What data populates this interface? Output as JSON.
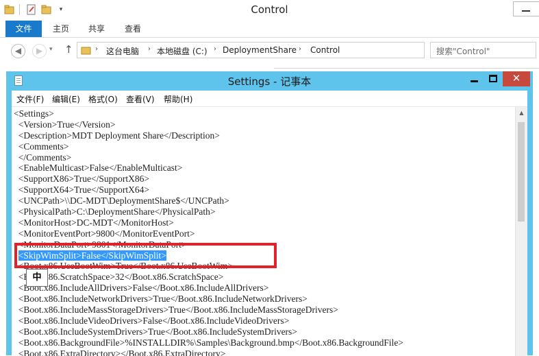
{
  "explorer": {
    "title": "Control",
    "ribbon_tabs": [
      "文件",
      "主页",
      "共享",
      "查看"
    ],
    "breadcrumb": [
      "这台电脑",
      "本地磁盘 (C:)",
      "DeploymentShare",
      "Control"
    ],
    "search_placeholder": "搜索\"Control\""
  },
  "notepad": {
    "title": "Settings - 记事本",
    "menu": [
      "文件(F)",
      "编辑(E)",
      "格式(O)",
      "查看(V)",
      "帮助(H)"
    ],
    "lines": [
      "<Settings>",
      "  <Version>True</Version>",
      "  <Description>MDT Deployment Share</Description>",
      "  <Comments>",
      "  </Comments>",
      "  <EnableMulticast>False</EnableMulticast>",
      "  <SupportX86>True</SupportX86>",
      "  <SupportX64>True</SupportX64>",
      "  <UNCPath>\\\\DC-MDT\\DeploymentShare$</UNCPath>",
      "  <PhysicalPath>C:\\DeploymentShare</PhysicalPath>",
      "  <MonitorHost>DC-MDT</MonitorHost>",
      "  <MonitorEventPort>9800</MonitorEventPort>",
      "  <MonitorDataPort>9801</MonitorDataPort>",
      "  <SkipWimSplit>False</SkipWimSplit>",
      "  <Boot.x86.UseBootWim>True</Boot.x86.UseBootWim>",
      "  <Boot.x86.ScratchSpace>32</Boot.x86.ScratchSpace>",
      "  <Boot.x86.IncludeAllDrivers>False</Boot.x86.IncludeAllDrivers>",
      "  <Boot.x86.IncludeNetworkDrivers>True</Boot.x86.IncludeNetworkDrivers>",
      "  <Boot.x86.IncludeMassStorageDrivers>True</Boot.x86.IncludeMassStorageDrivers>",
      "  <Boot.x86.IncludeVideoDrivers>False</Boot.x86.IncludeVideoDrivers>",
      "  <Boot.x86.IncludeSystemDrivers>True</Boot.x86.IncludeSystemDrivers>",
      "  <Boot.x86.BackgroundFile>%INSTALLDIR%\\Samples\\Background.bmp</Boot.x86.BackgroundFile>",
      "  <Boot.x86.ExtraDirectory></Boot.x86.ExtraDirectory>"
    ],
    "selected_line_index": 13
  },
  "ime": {
    "mode": "中"
  },
  "colors": {
    "notepad_titlebar": "#5ec4ec",
    "selection": "#3399ff",
    "highlight_box": "#e0232b",
    "close_button": "#c7483c",
    "file_tab": "#1979ca"
  }
}
